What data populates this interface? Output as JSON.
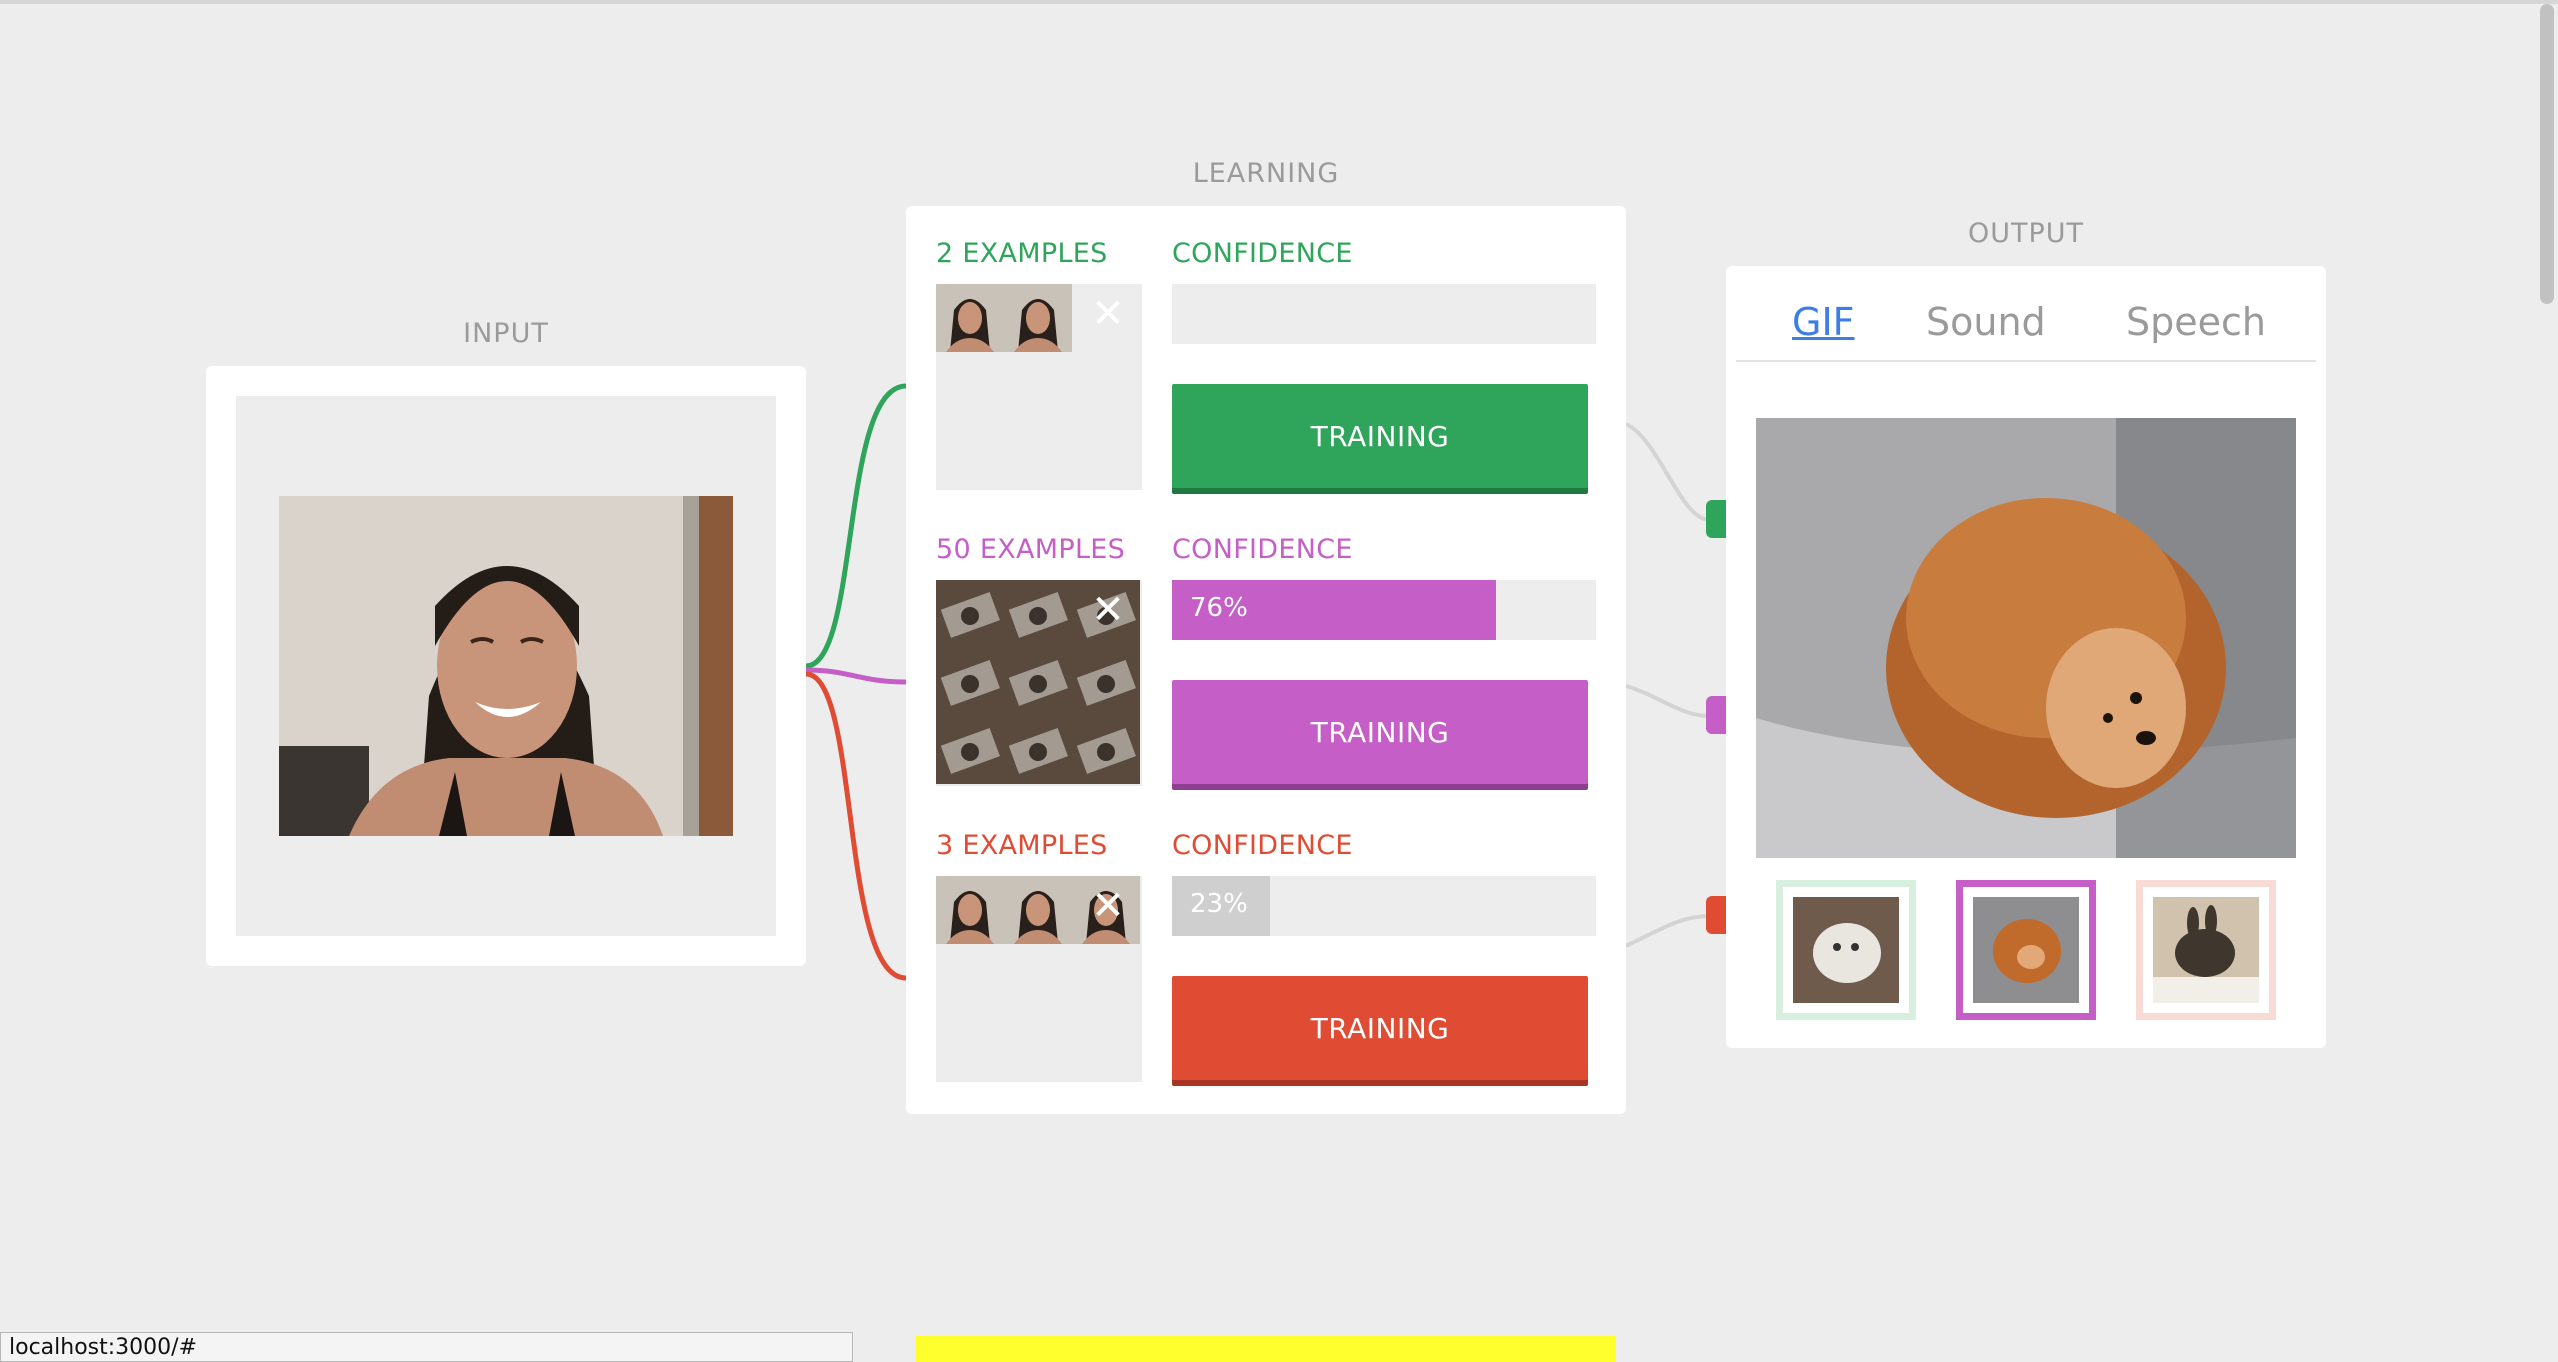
{
  "sections": {
    "input_title": "INPUT",
    "learning_title": "LEARNING",
    "output_title": "OUTPUT"
  },
  "classes": [
    {
      "examples_label": "2 EXAMPLES",
      "confidence_label": "CONFIDENCE",
      "confidence": 0,
      "confidence_text": "",
      "train_label": "TRAINING",
      "color": "#2fa55b",
      "example_count_shown": 2
    },
    {
      "examples_label": "50 EXAMPLES",
      "confidence_label": "CONFIDENCE",
      "confidence": 0.76,
      "confidence_text": "76%",
      "train_label": "TRAINING",
      "color": "#c55ec6",
      "example_count_shown": 9
    },
    {
      "examples_label": "3 EXAMPLES",
      "confidence_label": "CONFIDENCE",
      "confidence": 0.23,
      "confidence_text": "23%",
      "train_label": "TRAINING",
      "color": "#df4c33",
      "example_count_shown": 3
    }
  ],
  "output": {
    "tabs": [
      "GIF",
      "Sound",
      "Speech"
    ],
    "active_tab": "GIF"
  },
  "status_bar": {
    "url": "localhost:3000/#"
  },
  "colors": {
    "green": "#2fa55b",
    "purple": "#c55ec6",
    "red": "#df4c33",
    "low_confidence": "#cfcfcf",
    "tab_active": "#3d7de6"
  }
}
